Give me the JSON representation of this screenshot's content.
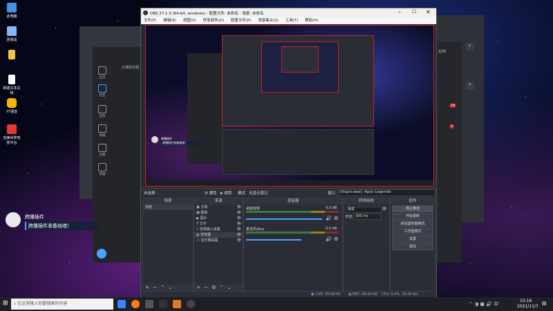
{
  "desktop": {
    "icons": [
      {
        "label": "此电脑",
        "color": "#4a90e2"
      },
      {
        "label": "回收站",
        "color": "#8ab4f8"
      },
      {
        "label": "",
        "color": "#f4c542"
      },
      {
        "label": "新建文本文档",
        "color": "#ffffff"
      },
      {
        "label": "YY语音",
        "color": "#f5b700"
      },
      {
        "label": "完美世界竞技平台",
        "color": "#e53935"
      }
    ]
  },
  "bg_app": {
    "tab_label": "比赛服务器",
    "side_items": [
      {
        "label": "主页"
      },
      {
        "label": "社区"
      },
      {
        "label": "任务"
      },
      {
        "label": "商城"
      },
      {
        "label": "仓库"
      },
      {
        "label": "武器"
      }
    ],
    "right_badges": [
      "3/30",
      "16",
      "3"
    ]
  },
  "overlay": {
    "name": "跨播插件",
    "message": "跨播插件准备就绪！"
  },
  "obs": {
    "title": "OBS 27.1.3 (64-bit, windows) - 配置文件: 未命名 - 场景: 未命名",
    "menu": [
      "文件(F)",
      "编辑(E)",
      "视图(V)",
      "停靠部件(D)",
      "配置文件(P)",
      "场景集合(S)",
      "工具(T)",
      "帮助(H)"
    ],
    "source_bar": {
      "no_source": "未选择",
      "properties": "属性",
      "filters": "滤镜",
      "mode": "模式",
      "fullscreen": "无显示窗口",
      "window_label": "窗口",
      "window_value": "[sfspro.exe]: Apex Legends"
    },
    "docks": {
      "scenes": {
        "title": "场景",
        "items": [
          "场景"
        ]
      },
      "sources": {
        "title": "来源",
        "items": [
          "文档",
          "图像",
          "图片",
          "文字",
          "音频输入采集",
          "浏览器",
          "显示器采集"
        ]
      },
      "mixer": {
        "title": "混音器",
        "tracks": [
          {
            "name": "桌面音频",
            "db": "0.0 dB"
          },
          {
            "name": "麦克风/Aux",
            "db": "0.0 dB"
          }
        ]
      },
      "transitions": {
        "title": "转场特效",
        "type": "渐变",
        "duration_label": "时长",
        "duration_value": "300 ms"
      },
      "controls": {
        "title": "控件",
        "buttons": [
          "停止推流",
          "开始录制",
          "启动虚拟摄像机",
          "工作室模式",
          "设置",
          "退出"
        ]
      }
    },
    "status": {
      "live": "LIVE: 00:00:00",
      "rec": "REC: 00:00:00",
      "cpu": "CPU: 0.4%, 30.00 fps"
    }
  },
  "taskbar": {
    "search_placeholder": "在这里输入你要搜索的内容",
    "time": "15:16",
    "date": "2021/11/7"
  },
  "colors": {
    "accent_red": "#c8202b",
    "obs_bg": "#272a33"
  }
}
